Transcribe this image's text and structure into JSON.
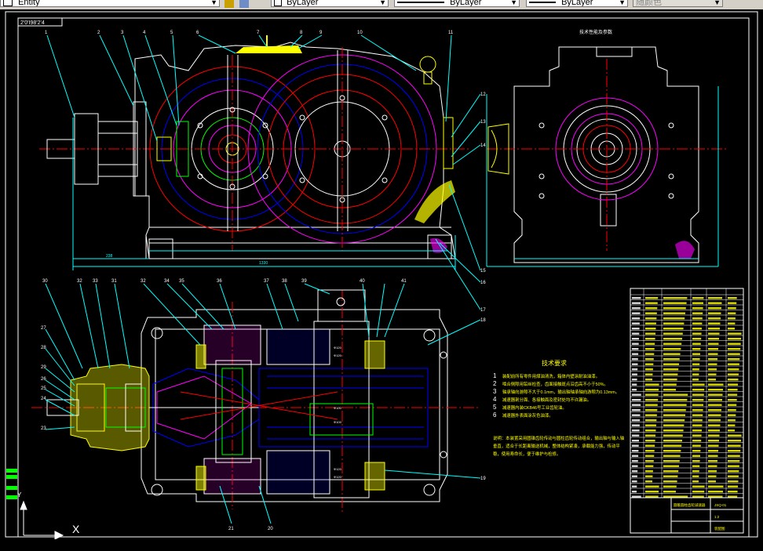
{
  "toolbar": {
    "layer_value": "Entity",
    "color_value": "ByLayer",
    "linetype_value": "ByLayer",
    "lineweight_value": "ByLayer",
    "plotstyle_value": "随颜色"
  },
  "drawing": {
    "top_view_title": "技术性能及参数",
    "tech_title": "技术要求",
    "tech_items": [
      {
        "n": "1",
        "text": "装配前所有零件用煤油清洗，箱体内壁涂耐油油漆。"
      },
      {
        "n": "2",
        "text": "啮合侧隙用铅丝检查，齿面接触斑点沿齿高不小于50%。"
      },
      {
        "n": "3",
        "text": "轴承轴向游隙不大于0.1mm，输出轴轴承轴向游隙为0.13mm。"
      },
      {
        "n": "4",
        "text": "减速器剖分面、各接触面及密封处均不许漏油。"
      },
      {
        "n": "5",
        "text": "减速器内装CKB46号工业齿轮油。"
      },
      {
        "n": "6",
        "text": "减速器外表面涂灰色油漆。"
      }
    ],
    "tech_paragraph": "说明：本装置采用圆锥齿轮传动与圆柱齿轮传动组合，输出轴与输入轴垂直，适合于长距离输送机械，整体结构紧凑，承载能力强，传动平稳，使用寿命长，便于维护与检修。",
    "left_tag": "2'0'Ⅰ98'2'4",
    "top_numbers": [
      "1",
      "2",
      "3",
      "4",
      "5",
      "6",
      "7",
      "8",
      "9",
      "10",
      "11"
    ],
    "right_numbers": [
      "12",
      "13",
      "14",
      "15",
      "16",
      "17"
    ],
    "bottom_numbers": [
      "26",
      "25",
      "24",
      "23",
      "22",
      "21",
      "20",
      "19",
      "18",
      "17"
    ],
    "plan_top_numbers": [
      "30",
      "32",
      "33",
      "31",
      "32",
      "34",
      "35",
      "36",
      "37",
      "38",
      "39",
      "40",
      "41"
    ],
    "plan_left_numbers": [
      "27",
      "28",
      "29",
      "26",
      "25",
      "24",
      "23"
    ],
    "plan_bottom_numbers": [
      "21",
      "20"
    ],
    "plan_right_numbers": [
      "18",
      "19"
    ],
    "title_block": {
      "drawing_name": "圆锥圆柱齿轮减速器",
      "drawing_code": "JSQ-01",
      "scale": "1:2",
      "sheet": "装配图"
    },
    "ucs": {
      "x_label": "X",
      "y_label": "Y"
    }
  },
  "colors": {
    "background": "#000000",
    "red": "#ff0000",
    "yellow": "#ffff00",
    "cyan": "#00ffff",
    "blue": "#0000ff",
    "green": "#00ff00",
    "magenta": "#ff00ff",
    "white": "#ffffff"
  }
}
